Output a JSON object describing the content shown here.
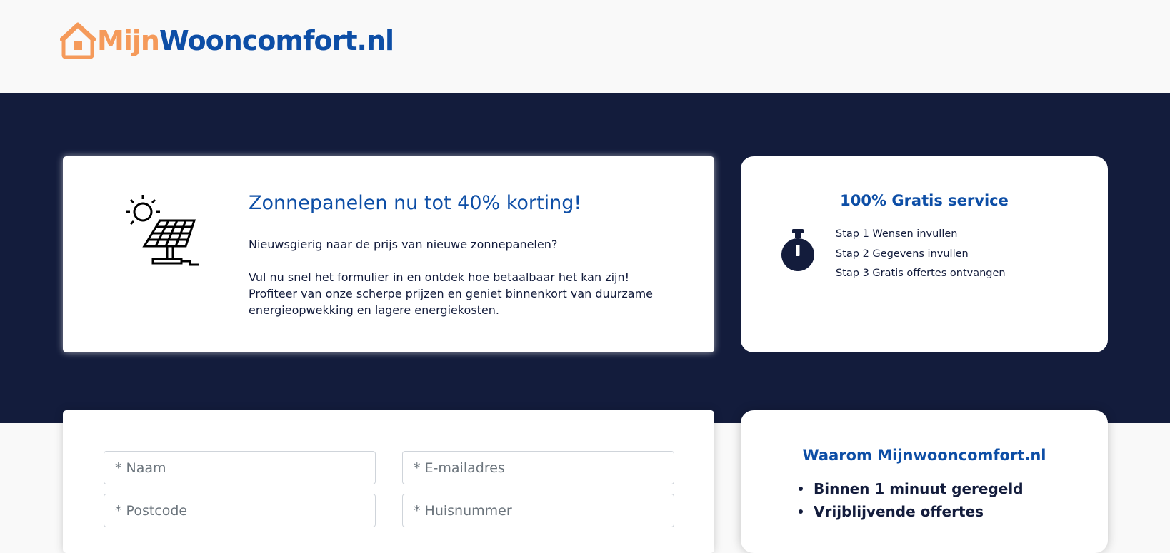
{
  "header": {
    "logo_part1": "Mijn",
    "logo_part2": "Wooncomfort.nl",
    "logo_icon": "house-icon"
  },
  "promo": {
    "icon": "solar-panel-icon",
    "title": "Zonnepanelen nu tot 40% korting!",
    "paragraph1": "Nieuwsgierig naar de prijs van nieuwe zonnepanelen?",
    "paragraph2": "Vul nu snel het formulier in en ontdek hoe betaalbaar het kan zijn! Profiteer van onze scherpe prijzen en geniet binnenkort van duurzame energieopwekking en lagere energiekosten."
  },
  "service": {
    "title": "100% Gratis service",
    "icon": "stopwatch-icon",
    "steps": [
      "Stap 1 Wensen invullen",
      "Stap 2 Gegevens invullen",
      "Stap 3 Gratis offertes ontvangen"
    ]
  },
  "form": {
    "name_placeholder": "* Naam",
    "email_placeholder": "* E-mailadres",
    "postcode_placeholder": "* Postcode",
    "housenumber_placeholder": "* Huisnummer"
  },
  "why": {
    "title": "Waarom Mijnwooncomfort.nl",
    "items": [
      "Binnen 1 minuut geregeld",
      "Vrijblijvende offertes"
    ]
  },
  "colors": {
    "brand_orange": "#f59a5a",
    "brand_blue": "#0d4ea6",
    "navy": "#131c3c"
  }
}
